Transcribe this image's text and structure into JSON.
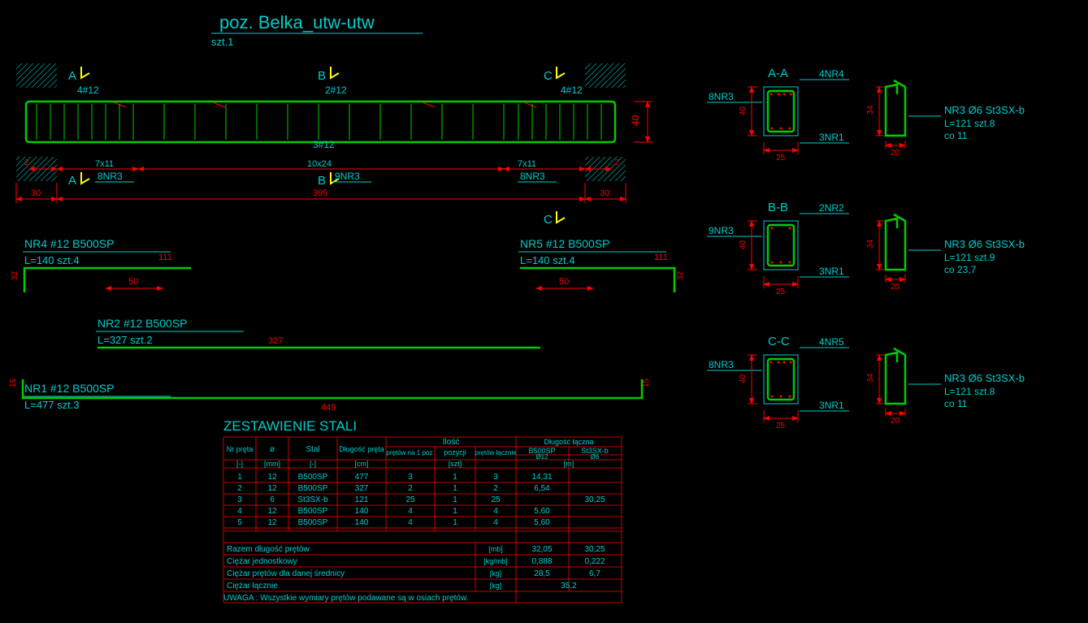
{
  "title_line1": "poz.   Belka_utw-utw",
  "title_line2": "szt.1",
  "section_marks": {
    "A": "A",
    "B": "B",
    "C": "C"
  },
  "elev": {
    "top_left_rebar": "4#12",
    "top_mid_rebar": "2#12",
    "top_right_rebar": "4#12",
    "mid_bar_label": "3#12",
    "dim_h_main": "40",
    "stirrup_left": "7x11",
    "stirrup_mid": "10x24",
    "stirrup_right": "7x11",
    "callout_left": "8NR3",
    "callout_mid": "9NR3",
    "callout_right": "8NR3",
    "span_left": "30",
    "span_main": "395",
    "span_right": "30",
    "spacer_left": "2",
    "spacer_right": "2"
  },
  "bars": {
    "nr4": {
      "title": "NR4   #12   B500SP",
      "sub": "L=140   szt.4",
      "len": "111",
      "side": "32",
      "hook": "50"
    },
    "nr5": {
      "title": "NR5   #12   B500SP",
      "sub": "L=140   szt.4",
      "len": "111",
      "side": "32",
      "hook": "50"
    },
    "nr2": {
      "title": "NR2   #12   B500SP",
      "sub": "L=327   szt.2",
      "len": "327"
    },
    "nr1": {
      "title": "NR1   #12   B500SP",
      "sub": "L=477   szt.3",
      "len": "449",
      "side": "15"
    }
  },
  "sections": {
    "aa": {
      "title": "A-A",
      "top": "4NR4",
      "bot": "3NR1",
      "left": "8NR3",
      "h": "40",
      "w": "25"
    },
    "bb": {
      "title": "B-B",
      "top": "2NR2",
      "bot": "3NR1",
      "left": "9NR3",
      "h": "40",
      "w": "25"
    },
    "cc": {
      "title": "C-C",
      "top": "4NR5",
      "bot": "3NR1",
      "left": "8NR3",
      "h": "40",
      "w": "25"
    }
  },
  "stirrup_detail": {
    "aa": {
      "title": "NR3   Ø6   St3SX-b",
      "l2": "L=121   szt.8",
      "l3": "co 11",
      "h": "34",
      "w": "20"
    },
    "bb": {
      "title": "NR3   Ø6   St3SX-b",
      "l2": "L=121   szt.9",
      "l3": "co 23,7",
      "h": "34",
      "w": "20"
    },
    "cc": {
      "title": "NR3   Ø6   St3SX-b",
      "l2": "L=121   szt.8",
      "l3": "co 11",
      "h": "34",
      "w": "20"
    }
  },
  "table": {
    "title": "ZESTAWIENIE STALI",
    "h": {
      "nr": "Nr pręta",
      "phi": "ø",
      "stal": "Stal",
      "dl": "Długość pręta",
      "ilosc": "Ilość",
      "p_poz": "prętów na 1 poz.",
      "poz": "pozycji",
      "p_lacz": "prętów łącznie",
      "dl_lacz": "Długość łączna",
      "b500": "B500SP",
      "st3": "St3SX-b",
      "d12": "Ø12",
      "d6": "Ø6"
    },
    "u": {
      "dash": "[-]",
      "mm": "[mm]",
      "cm": "[cm]",
      "szt": "[szt]",
      "m": "[m]",
      "mb": "[mb]",
      "kgmb": "[kg/mb]",
      "kg": "[kg]"
    },
    "rows": [
      {
        "nr": "1",
        "phi": "12",
        "stal": "B500SP",
        "dl": "477",
        "p1": "3",
        "p2": "1",
        "p3": "3",
        "b": "14,31",
        "s": ""
      },
      {
        "nr": "2",
        "phi": "12",
        "stal": "B500SP",
        "dl": "327",
        "p1": "2",
        "p2": "1",
        "p3": "2",
        "b": "6,54",
        "s": ""
      },
      {
        "nr": "3",
        "phi": "6",
        "stal": "St3SX-b",
        "dl": "121",
        "p1": "25",
        "p2": "1",
        "p3": "25",
        "b": "",
        "s": "30,25"
      },
      {
        "nr": "4",
        "phi": "12",
        "stal": "B500SP",
        "dl": "140",
        "p1": "4",
        "p2": "1",
        "p3": "4",
        "b": "5,60",
        "s": ""
      },
      {
        "nr": "5",
        "phi": "12",
        "stal": "B500SP",
        "dl": "140",
        "p1": "4",
        "p2": "1",
        "p3": "4",
        "b": "5,60",
        "s": ""
      }
    ],
    "sum1": {
      "label": "Razem długość prętów",
      "b": "32,05",
      "s": "30,25"
    },
    "sum2": {
      "label": "Ciężar jednostkowy",
      "b": "0,888",
      "s": "0,222"
    },
    "sum3": {
      "label": "Ciężar prętów dla danej średnicy",
      "b": "28,5",
      "s": "6,7"
    },
    "sum4": {
      "label": "Ciężar łącznie",
      "val": "35,2"
    },
    "note": "UWAGA :   Wszystkie wymiary prętów podawane są w osiach prętów."
  }
}
